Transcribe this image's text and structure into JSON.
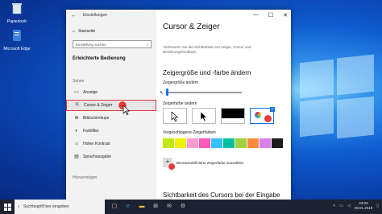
{
  "desktop": {
    "icons": [
      {
        "name": "recycle-bin",
        "label": "Papierkorb"
      },
      {
        "name": "microsoft-edge",
        "label": "Microsoft Edge"
      }
    ]
  },
  "window": {
    "title": "Einstellungen",
    "controls": {
      "minimize": "—",
      "maximize": "☐",
      "close": "✕"
    }
  },
  "sidebar": {
    "home_label": "Startseite",
    "search_placeholder": "Einstellung suchen",
    "section_title": "Erleichterte Bedienung",
    "group_sehen": "Sehen",
    "group_hoeren": "Hörvermögen",
    "items": [
      {
        "label": "Anzeige",
        "icon": "display-icon"
      },
      {
        "label": "Cursor & Zeiger",
        "icon": "cursor-icon"
      },
      {
        "label": "Bildschirmlupe",
        "icon": "magnifier-icon"
      },
      {
        "label": "Farbfilter",
        "icon": "color-filter-icon"
      },
      {
        "label": "Hoher Kontrast",
        "icon": "contrast-icon"
      },
      {
        "label": "Sprachausgabe",
        "icon": "narrator-icon"
      }
    ]
  },
  "main": {
    "title": "Cursor & Zeiger",
    "description": "Verbessern Sie die Sichtbarkeit von Zeiger, Cursor und Berührungsfeedback.",
    "section_pointer": "Zeigergröße und -farbe ändern",
    "size_label": "Zeigergröße ändern",
    "color_label": "Zeigerfarbe ändern",
    "suggested_label": "Vorgeschlagene Zeigerfarben",
    "custom_label": "Benutzerdefinierte Zeigerfarbe auswählen",
    "add_symbol": "+",
    "section_cursor": "Sichtbarkeit des Cursors bei der Eingabe",
    "slider_value": 0.02,
    "suggested_colors": [
      "#c2e814",
      "#f1f100",
      "#ff9ad1",
      "#ff5ab8",
      "#36c0ff",
      "#00c0a0",
      "#9dd43c",
      "#ff8a3c",
      "#d97ff0",
      "#1c1c1c"
    ]
  },
  "taskbar": {
    "search_placeholder": "Suchbegriff hier eingeben",
    "time": "23:03",
    "date": "29.01.2019"
  },
  "colors": {
    "accent": "#1a73e8",
    "highlight": "#e0343c"
  }
}
